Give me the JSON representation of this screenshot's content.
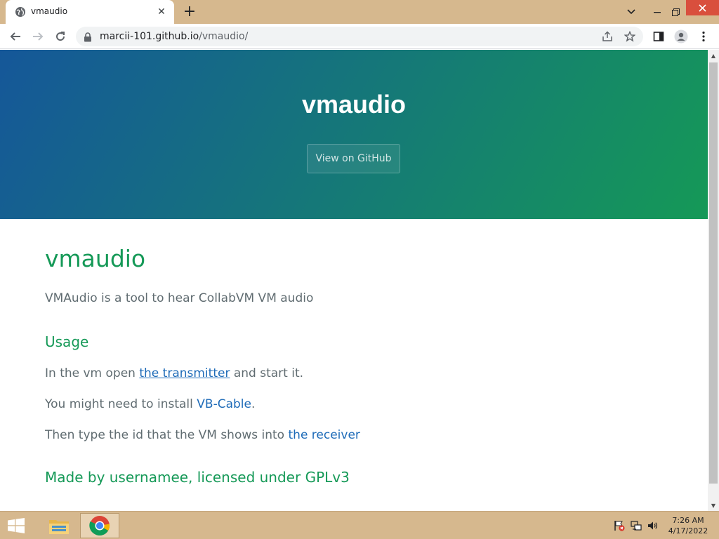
{
  "browser": {
    "tab": {
      "title": "vmaudio"
    },
    "address": {
      "host": "marcii-101.github.io",
      "path": "/vmaudio/"
    }
  },
  "hero": {
    "title": "vmaudio",
    "button_label": "View on GitHub"
  },
  "main": {
    "heading": "vmaudio",
    "intro": "VMAudio is a tool to hear CollabVM VM audio",
    "usage_heading": "Usage",
    "step1": {
      "before": "In the vm open ",
      "link": "the transmitter",
      "after": " and start it."
    },
    "step2": {
      "before": "You might need to install ",
      "link": "VB-Cable",
      "after": "."
    },
    "step3": {
      "before": "Then type the id that the VM shows into ",
      "link": "the receiver"
    },
    "footer_heading": "Made by usernamee, licensed under GPLv3"
  },
  "taskbar": {
    "time": "7:26 AM",
    "date": "4/17/2022"
  },
  "colors": {
    "hero_start": "#155799",
    "hero_end": "#159957",
    "heading": "#159957",
    "link": "#1e6bb8",
    "text": "#606c71",
    "tabstrip": "#d6b88e"
  },
  "icons": {
    "tab_favicon": "globe-icon",
    "back": "back-arrow-icon",
    "forward": "forward-arrow-icon",
    "reload": "reload-icon",
    "lock": "lock-icon",
    "share": "share-icon",
    "bookmark": "star-icon",
    "side_panel": "side-panel-icon",
    "profile": "profile-icon",
    "menu": "kebab-menu-icon"
  }
}
